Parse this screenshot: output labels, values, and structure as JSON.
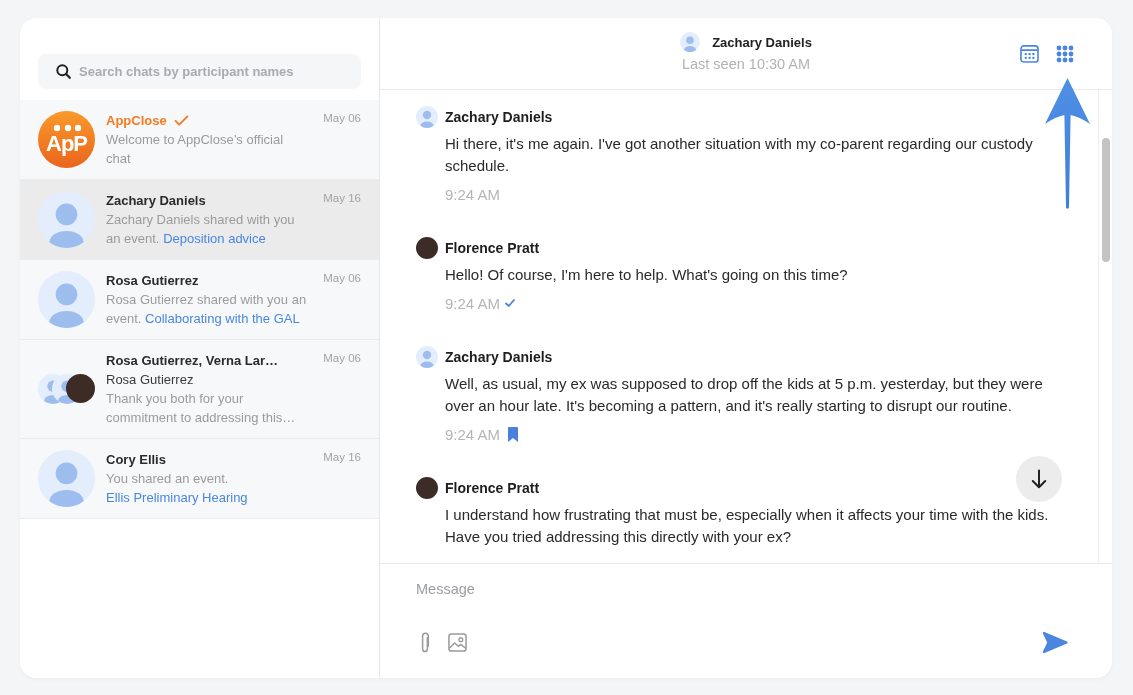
{
  "search": {
    "placeholder": "Search chats by participant names"
  },
  "chats": [
    {
      "kind": "logo",
      "logo_text": "ApP",
      "name": "AppClose",
      "verified": true,
      "date": "May 06",
      "preview": "Welcome to AppClose’s official chat",
      "selected": false
    },
    {
      "kind": "person",
      "name": "Zachary Daniels",
      "date": "May 16",
      "preview": "Zachary Daniels shared with you an event.",
      "link": "Deposition advice",
      "selected": true
    },
    {
      "kind": "person",
      "name": "Rosa Gutierrez",
      "date": "May 06",
      "preview": "Rosa Gutierrez shared with you an event.",
      "link": "Collaborating with the GAL",
      "selected": false
    },
    {
      "kind": "group",
      "name": "Rosa Gutierrez, Verna Lar…",
      "date": "May 06",
      "sender": "Rosa Gutierrez",
      "preview": "Thank you both for your commitment to addressing this…",
      "selected": false
    },
    {
      "kind": "person",
      "name": "Cory Ellis",
      "date": "May 16",
      "preview": "You shared an event.",
      "link": "Ellis Preliminary Hearing",
      "selected": false
    }
  ],
  "conversation": {
    "name": "Zachary Daniels",
    "last_seen": "Last seen 10:30 AM"
  },
  "messages": [
    {
      "kind": "silhouette",
      "sender": "Zachary Daniels",
      "text": "Hi there, it's me again. I've got another situation with my co-parent regarding our custody schedule.",
      "time": "9:24 AM",
      "read": false,
      "bookmarked": false
    },
    {
      "kind": "photo",
      "sender": "Florence Pratt",
      "text": "Hello! Of course, I'm here to help. What's going on this time?",
      "time": "9:24 AM",
      "read": true,
      "bookmarked": false
    },
    {
      "kind": "silhouette",
      "sender": "Zachary Daniels",
      "text": "Well, as usual, my ex was supposed to drop off the kids at 5 p.m. yesterday, but they were over an hour late. It's becoming a pattern, and it's really starting to disrupt our routine.",
      "time": "9:24 AM",
      "read": false,
      "bookmarked": true
    },
    {
      "kind": "photo",
      "sender": "Florence Pratt",
      "text": "I understand how frustrating that must be, especially when it affects your time with the kids. Have you tried addressing this directly with your ex?"
    }
  ],
  "composer": {
    "placeholder": "Message"
  }
}
